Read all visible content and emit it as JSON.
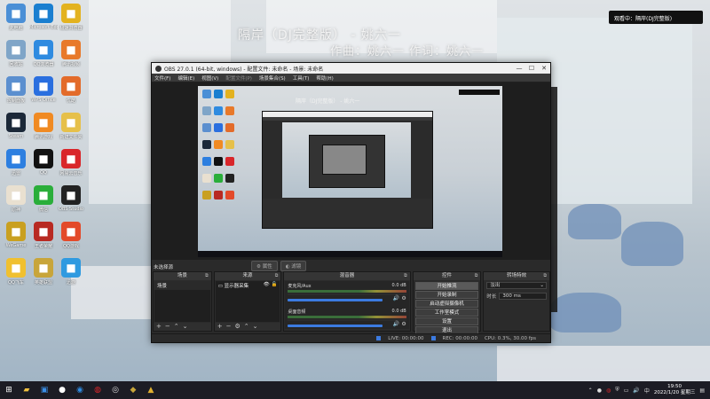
{
  "desktop": {
    "icons": [
      {
        "label": "此电脑",
        "icon": "computer-icon",
        "color": "#4a8fd6"
      },
      {
        "label": "Microsoft Edge",
        "icon": "edge-icon",
        "color": "#1a7fd0"
      },
      {
        "label": "极速浏览器",
        "icon": "browser-icon",
        "color": "#e3b21f"
      },
      {
        "label": "回收站",
        "icon": "recycle-bin-icon",
        "color": "#7fa5c8"
      },
      {
        "label": "QQ浏览器",
        "icon": "qq-browser-icon",
        "color": "#2f8be0"
      },
      {
        "label": "腾讯视频",
        "icon": "tencent-video-icon",
        "color": "#e8792a"
      },
      {
        "label": "控制面板",
        "icon": "control-panel-icon",
        "color": "#5b8fcf"
      },
      {
        "label": "WPS Office",
        "icon": "wps-icon",
        "color": "#2a6fdf"
      },
      {
        "label": "优酷",
        "icon": "youku-icon",
        "color": "#e36b2a"
      },
      {
        "label": "Steam",
        "icon": "steam-icon",
        "color": "#1b2838"
      },
      {
        "label": "腾讯游戏",
        "icon": "game-icon",
        "color": "#f08a22"
      },
      {
        "label": "新建文件夹",
        "icon": "folder-icon",
        "color": "#e6c04a"
      },
      {
        "label": "迅雷",
        "icon": "thunder-icon",
        "color": "#2d7fe0"
      },
      {
        "label": "QQ",
        "icon": "qq-icon",
        "color": "#111111"
      },
      {
        "label": "网易云音乐",
        "icon": "netease-music-icon",
        "color": "#d9262a"
      },
      {
        "label": "原神",
        "icon": "genshin-icon",
        "color": "#e9e0d0"
      },
      {
        "label": "微信",
        "icon": "wechat-icon",
        "color": "#2aae3a"
      },
      {
        "label": "OBS Studio",
        "icon": "obs-icon",
        "color": "#222222"
      },
      {
        "label": "WeGame",
        "icon": "wegame-icon",
        "color": "#c9a020"
      },
      {
        "label": "王者荣耀",
        "icon": "honor-of-kings-icon",
        "color": "#b82a22"
      },
      {
        "label": "QQ游戏",
        "icon": "qq-game-icon",
        "color": "#e34a2a"
      },
      {
        "label": "QQ飞车",
        "icon": "qq-speed-icon",
        "color": "#f0c030"
      },
      {
        "label": "英雄联盟",
        "icon": "lol-icon",
        "color": "#c8a53a"
      },
      {
        "label": "迅游",
        "icon": "xunyou-icon",
        "color": "#2f9ae0"
      }
    ],
    "lyric_line1": "隔岸（DJ完整版） - 姚六一",
    "lyric_line2": "作曲：姚六一 作词：姚六一",
    "notification": "观看中：隔岸(DJ完整版)"
  },
  "obs": {
    "title": "OBS 27.0.1 (64-bit, windows) - 配置文件: 未命名 - 场景: 未命名",
    "menu": [
      "文件(F)",
      "编辑(E)",
      "视图(V)",
      "配置文件(P)",
      "场景集合(S)",
      "工具(T)",
      "帮助(H)"
    ],
    "no_source": "未选择源",
    "properties_btn": "属性",
    "filters_btn": "滤镜",
    "docks": {
      "scenes": "场景",
      "sources": "来源",
      "mixer": "混音器",
      "transitions": "转场特效",
      "controls": "控件"
    },
    "scene_item": "场景",
    "source_item": "显示器采集",
    "mixer_tracks": [
      {
        "name": "麦克风/Aux",
        "db": "0.0 dB"
      },
      {
        "name": "桌面音频",
        "db": "0.0 dB"
      }
    ],
    "controls": [
      "开始推流",
      "开始录制",
      "启动虚拟摄像机",
      "工作室模式",
      "设置",
      "退出"
    ],
    "transition": {
      "type": "淡出",
      "duration_label": "时长",
      "duration": "300 ms"
    },
    "status": {
      "live": "LIVE: 00:00:00",
      "rec": "REC: 00:00:00",
      "cpu": "CPU: 0.3%, 30.00 fps"
    }
  },
  "taskbar": {
    "time": "19:50",
    "date": "2022/1/20 星期三",
    "icons": [
      "start-icon",
      "folder-icon",
      "store-icon",
      "qq-icon",
      "qq-browser-icon",
      "netease-music-icon",
      "obs-icon",
      "lol-icon",
      "wegame-icon"
    ]
  }
}
